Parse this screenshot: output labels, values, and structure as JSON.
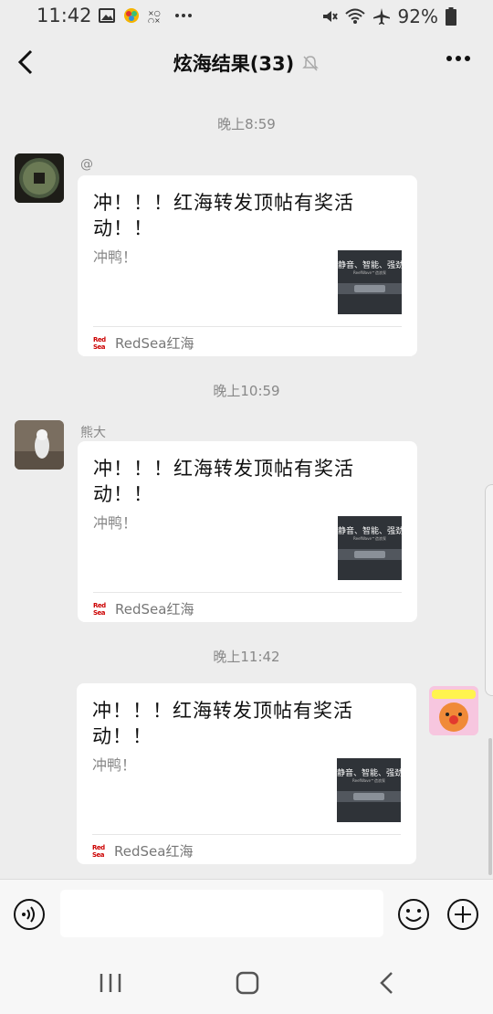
{
  "status_bar": {
    "time": "11:42",
    "battery": "92%"
  },
  "header": {
    "title": "炫海结果(33)"
  },
  "messages": [
    {
      "timestamp": "晚上8:59",
      "sender": "@",
      "title": "冲！！！红海转发顶帖有奖活动！！",
      "desc": "冲鸭！",
      "thumb_text": "静音、智能、强劲",
      "thumb_sub": "ReefWave™造浪泵",
      "source": "RedSea红海",
      "source_logo": "Red Sea"
    },
    {
      "timestamp": "晚上10:59",
      "sender": "熊大",
      "title": "冲！！！红海转发顶帖有奖活动！！",
      "desc": "冲鸭！",
      "thumb_text": "静音、智能、强劲",
      "thumb_sub": "ReefWave™造浪泵",
      "source": "RedSea红海",
      "source_logo": "Red Sea"
    },
    {
      "timestamp": "晚上11:42",
      "sender": "",
      "title": "冲！！！红海转发顶帖有奖活动！！",
      "desc": "冲鸭！",
      "thumb_text": "静音、智能、强劲",
      "thumb_sub": "ReefWave™造浪泵",
      "source": "RedSea红海",
      "source_logo": "Red Sea"
    }
  ],
  "icons": {
    "back": "chevron-left-icon",
    "mute": "bell-off-icon",
    "more": "more-dots-icon",
    "voice": "voice-icon",
    "emoji": "emoji-icon",
    "plus": "plus-icon"
  },
  "colors": {
    "background": "#ededed",
    "bubble": "#ffffff",
    "timestamp": "#888888"
  }
}
